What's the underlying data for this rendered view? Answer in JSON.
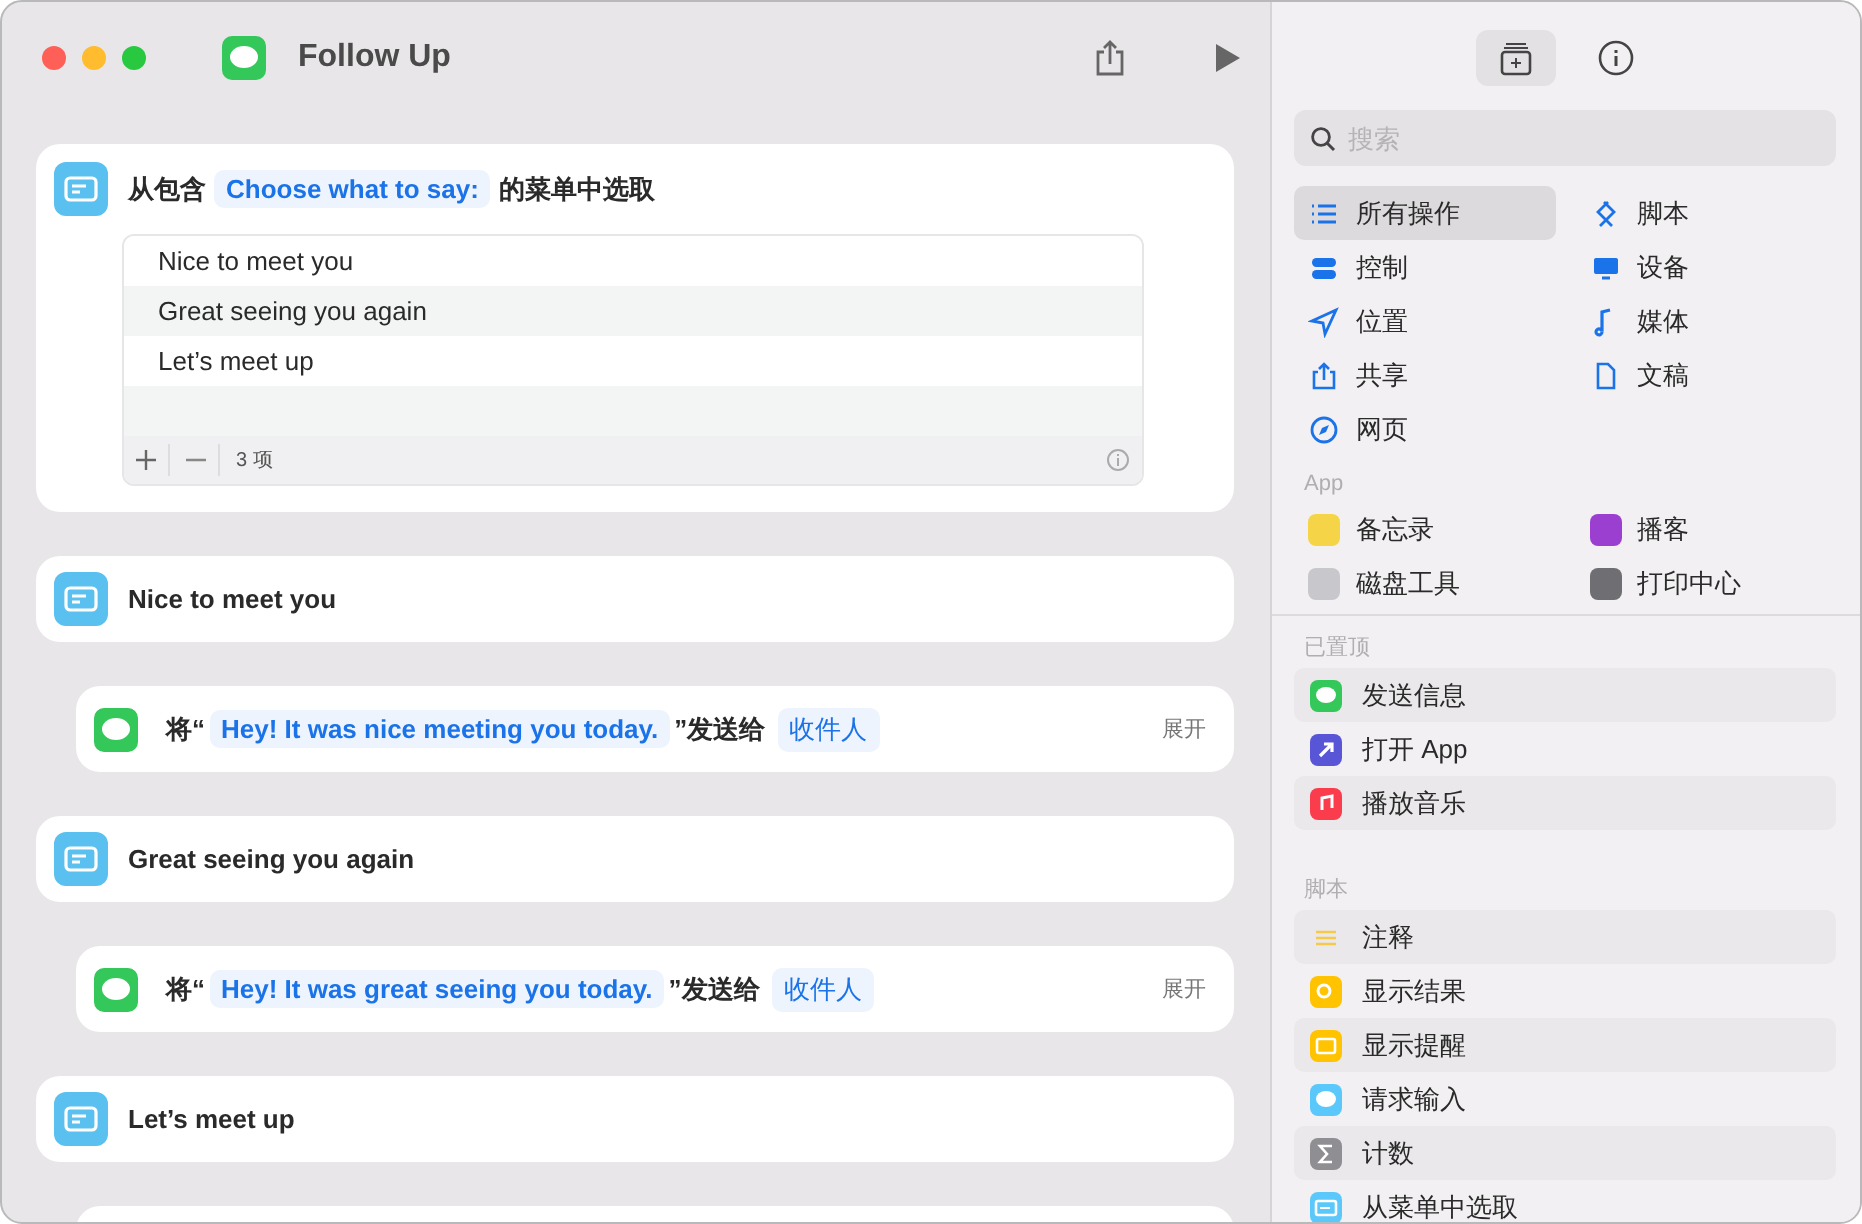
{
  "window": {
    "title": "Follow Up"
  },
  "menu_action": {
    "prefix": "从包含",
    "prompt": "Choose what to say:",
    "suffix": "的菜单中选取",
    "count": "3 项",
    "items": [
      {
        "label": "Nice to meet you"
      },
      {
        "label": "Great seeing you again"
      },
      {
        "label": "Let’s meet up"
      }
    ]
  },
  "steps": [
    {
      "kind": "case",
      "title": "Nice to meet you"
    },
    {
      "kind": "message",
      "prefix": "将“",
      "text": "Hey! It was nice meeting you today.",
      "middle": "”发送给",
      "recipient": "收件人",
      "expand": "展开"
    },
    {
      "kind": "case",
      "title": "Great seeing you again"
    },
    {
      "kind": "message",
      "prefix": "将“",
      "text": "Hey! It was great seeing you today.",
      "middle": "”发送给",
      "recipient": "收件人",
      "expand": "展开"
    },
    {
      "kind": "case",
      "title": "Let’s meet up"
    },
    {
      "kind": "partial"
    }
  ],
  "sidebar": {
    "tabs": [
      {
        "kind": "library",
        "selected": true
      },
      {
        "kind": "info",
        "selected": false
      }
    ],
    "search": {
      "placeholder": "搜索"
    },
    "categories": [
      {
        "label": "所有操作",
        "kind": "list",
        "selected": true
      },
      {
        "label": "脚本",
        "kind": "script",
        "selected": false
      },
      {
        "label": "控制",
        "kind": "toggle",
        "selected": false
      },
      {
        "label": "设备",
        "kind": "display",
        "selected": false
      },
      {
        "label": "位置",
        "kind": "location",
        "selected": false
      },
      {
        "label": "媒体",
        "kind": "note",
        "selected": false
      },
      {
        "label": "共享",
        "kind": "share",
        "selected": false
      },
      {
        "label": "文稿",
        "kind": "doc",
        "selected": false
      },
      {
        "label": "网页",
        "kind": "compass",
        "selected": false
      }
    ],
    "apps_heading": "App",
    "apps": [
      {
        "label": "备忘录",
        "color": "#f5d547"
      },
      {
        "label": "播客",
        "color": "#9b3fd1"
      },
      {
        "label": "磁盘工具",
        "color": "#c8c8cc"
      },
      {
        "label": "打印中心",
        "color": "#6e6e73"
      }
    ],
    "sections": [
      {
        "heading": "已置顶",
        "items": [
          {
            "label": "发送信息",
            "kind": "bubble",
            "color": "#34c759"
          },
          {
            "label": "打开 App",
            "kind": "arrow",
            "color": "#5856d6"
          },
          {
            "label": "播放音乐",
            "kind": "note",
            "color": "#fa3c4c"
          }
        ]
      },
      {
        "heading": "脚本",
        "items": [
          {
            "label": "注释",
            "kind": "lines",
            "color": "#f7c948"
          },
          {
            "label": "显示结果",
            "kind": "search",
            "color": "#ffc300"
          },
          {
            "label": "显示提醒",
            "kind": "window",
            "color": "#ffc300"
          },
          {
            "label": "请求输入",
            "kind": "bubble",
            "color": "#5ac8fa"
          },
          {
            "label": "计数",
            "kind": "sigma",
            "color": "#8e8e93"
          },
          {
            "label": "从菜单中选取",
            "kind": "menu",
            "color": "#5ac8fa"
          }
        ]
      }
    ]
  }
}
